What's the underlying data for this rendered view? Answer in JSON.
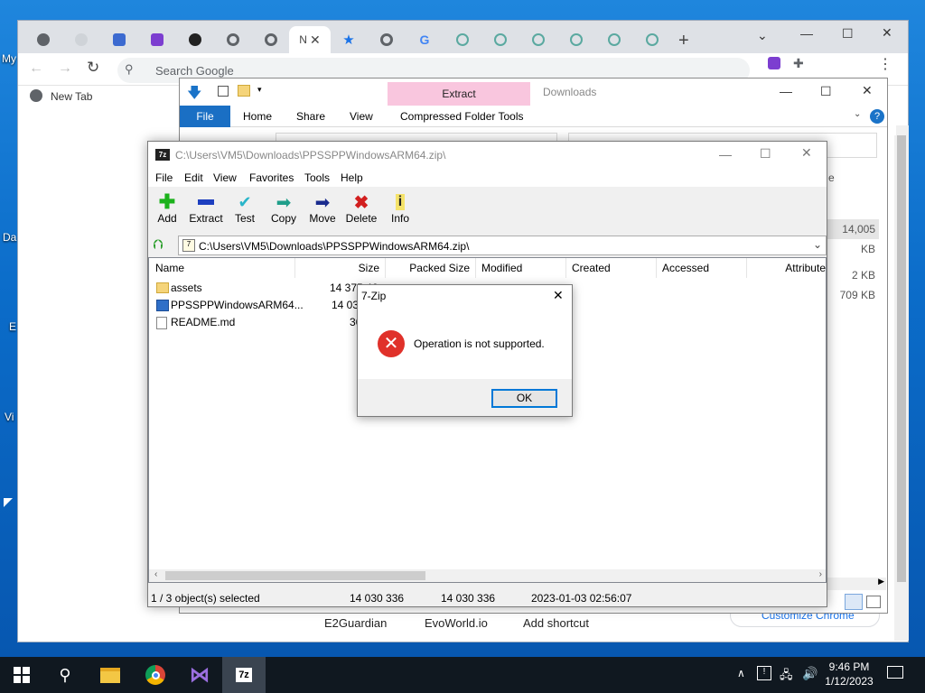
{
  "desktop": {
    "icons": [
      "My",
      "Da",
      "E",
      "Vi"
    ]
  },
  "chrome": {
    "tab_active_label": "N",
    "search_placeholder": "Search Google",
    "bookmark": "New Tab",
    "shortcuts": [
      "E2Guardian",
      "EvoWorld.io",
      "Add shortcut"
    ],
    "customize": "Customize Chrome",
    "new_tab_symbol": "+"
  },
  "explorer": {
    "title": "Downloads",
    "contextual_tab": "Extract",
    "tabs": [
      "File",
      "Home",
      "Share",
      "View",
      "Compressed Folder Tools"
    ],
    "right_col": {
      "size_partial": "14,005 KB",
      "row1_size": "2 KB",
      "row2_size": "709 KB",
      "header_partial": "e"
    }
  },
  "sevenzip": {
    "title": "C:\\Users\\VM5\\Downloads\\PPSSPPWindowsARM64.zip\\",
    "menu": [
      "File",
      "Edit",
      "View",
      "Favorites",
      "Tools",
      "Help"
    ],
    "toolbar": [
      "Add",
      "Extract",
      "Test",
      "Copy",
      "Move",
      "Delete",
      "Info"
    ],
    "address": "C:\\Users\\VM5\\Downloads\\PPSSPPWindowsARM64.zip\\",
    "columns": [
      "Name",
      "Size",
      "Packed Size",
      "Modified",
      "Created",
      "Accessed",
      "Attribute"
    ],
    "rows": [
      {
        "name": "assets",
        "size": "14 375 46",
        "packed": "",
        "modified": ""
      },
      {
        "name": "PPSSPPWindowsARM64...",
        "size": "14 030",
        "packed": "",
        "modified": ""
      },
      {
        "name": "README.md",
        "size": "36",
        "packed": "",
        "modified": ""
      }
    ],
    "status": {
      "selected": "1 / 3 object(s) selected",
      "size": "14 030 336",
      "packed": "14 030 336",
      "modified": "2023-01-03 02:56:07"
    }
  },
  "dialog": {
    "title": "7-Zip",
    "message": "Operation is not supported.",
    "ok": "OK"
  },
  "taskbar": {
    "time": "9:46 PM",
    "date": "1/12/2023"
  }
}
